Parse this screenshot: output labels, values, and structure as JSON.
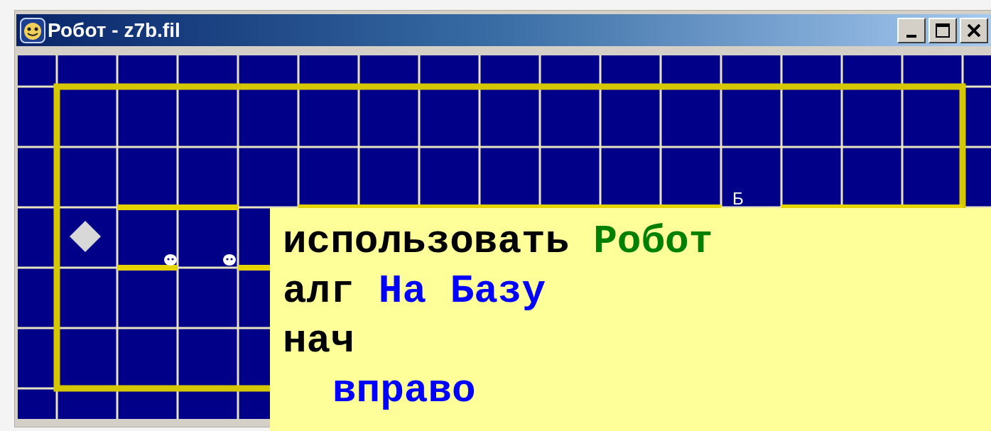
{
  "window": {
    "title": "Робот - z7b.fil",
    "buttons": [
      {
        "kind": "minimize"
      },
      {
        "kind": "maximize"
      },
      {
        "kind": "close"
      }
    ]
  },
  "field": {
    "base_label": "Б"
  },
  "code": [
    {
      "segments": [
        {
          "kind": "keyword",
          "text": "использовать"
        },
        {
          "kind": "module",
          "text": "Робот"
        }
      ]
    },
    {
      "segments": [
        {
          "kind": "keyword",
          "text": "алг"
        },
        {
          "kind": "name",
          "text": "На Базу"
        }
      ]
    },
    {
      "segments": [
        {
          "kind": "keyword",
          "text": "нач"
        }
      ],
      "children": [
        {
          "segments": [
            {
              "kind": "command",
              "text": "вправо"
            }
          ]
        }
      ]
    }
  ]
}
